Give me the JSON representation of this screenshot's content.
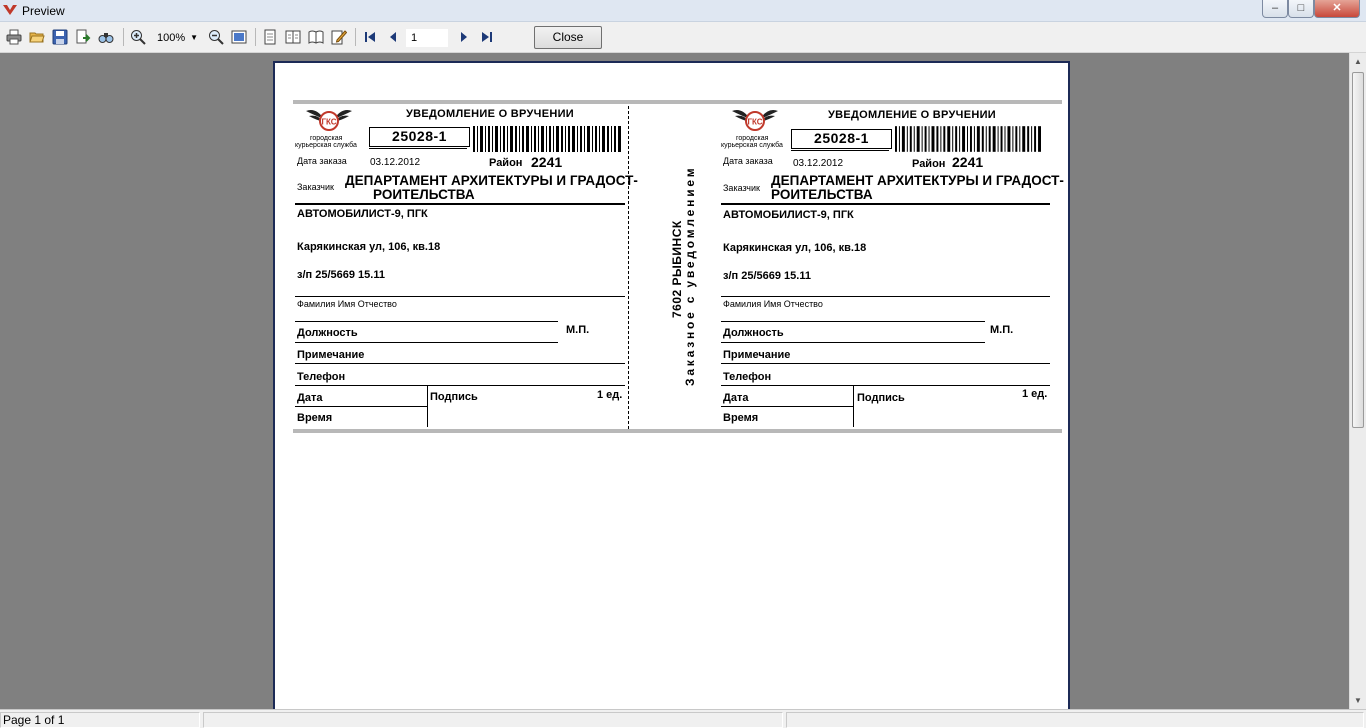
{
  "window": {
    "title": "Preview",
    "min": "–",
    "max": "□",
    "close": "✕"
  },
  "toolbar": {
    "zoom": "100%",
    "page_input": "1",
    "close_label": "Close",
    "icons": [
      "print-icon",
      "open-icon",
      "save-icon",
      "export-icon",
      "find-icon",
      "zoom-in-icon",
      "zoom-out-icon",
      "fit-page-icon",
      "single-page-icon",
      "two-pages-icon",
      "book-icon",
      "edit-icon",
      "first-page-icon",
      "prev-page-icon",
      "next-page-icon",
      "last-page-icon"
    ]
  },
  "statusbar": {
    "page_info": "Page 1 of 1"
  },
  "notice": {
    "header": "УВЕДОМЛЕНИЕ О ВРУЧЕНИИ",
    "logo_line1": "городская",
    "logo_line2": "курьерская служба",
    "logo_mark": "ГКС",
    "order_number": "25028-1",
    "date_label": "Дата заказа",
    "date": "03.12.2012",
    "district_label": "Район",
    "district": "2241",
    "customer_label": "Заказчик",
    "customer_line1": "ДЕПАРТАМЕНТ АРХИТЕКТУРЫ И ГРАДОСТ-",
    "customer_line2": "РОИТЕЛЬСТВА",
    "recipient": "АВТОМОБИЛИСТ-9, ПГК",
    "address": "Карякинская ул, 106, кв.18",
    "ref": "з/п 25/5669 15.11",
    "fio_label": "Фамилия Имя Отчество",
    "position_label": "Должность",
    "seal_label": "М.П.",
    "note_label": "Примечание",
    "phone_label": "Телефон",
    "date_field_label": "Дата",
    "signature_label": "Подпись",
    "time_label": "Время",
    "qty": "1 ед."
  },
  "spine": {
    "city": "7602 РЫБИНСК",
    "kind": "Заказное с уведомлением"
  }
}
